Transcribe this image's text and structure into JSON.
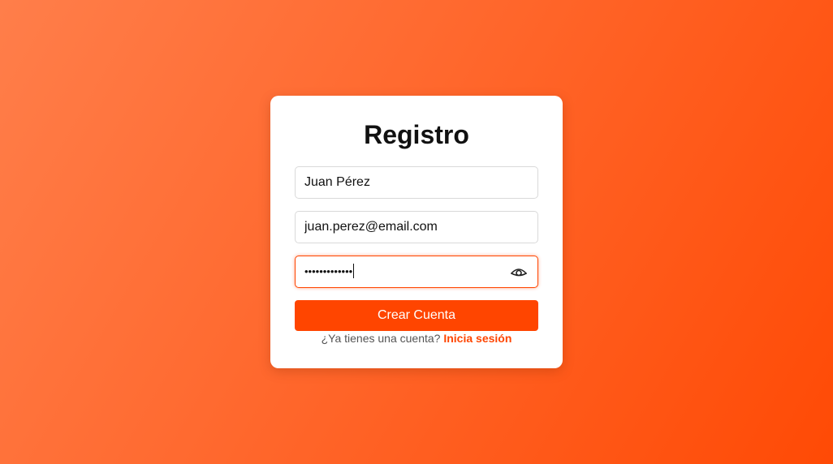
{
  "form": {
    "title": "Registro",
    "name_value": "Juan Pérez",
    "email_value": "juan.perez@email.com",
    "password_masked": "•••••••••••••",
    "password_toggle_icon": "eye-icon",
    "submit_label": "Crear Cuenta",
    "login_prompt": "¿Ya tienes una cuenta?",
    "login_link": "Inicia sesión"
  },
  "colors": {
    "accent": "#ff4500",
    "background_start": "#ff7e4a",
    "background_end": "#ff4a05",
    "card": "#ffffff"
  }
}
